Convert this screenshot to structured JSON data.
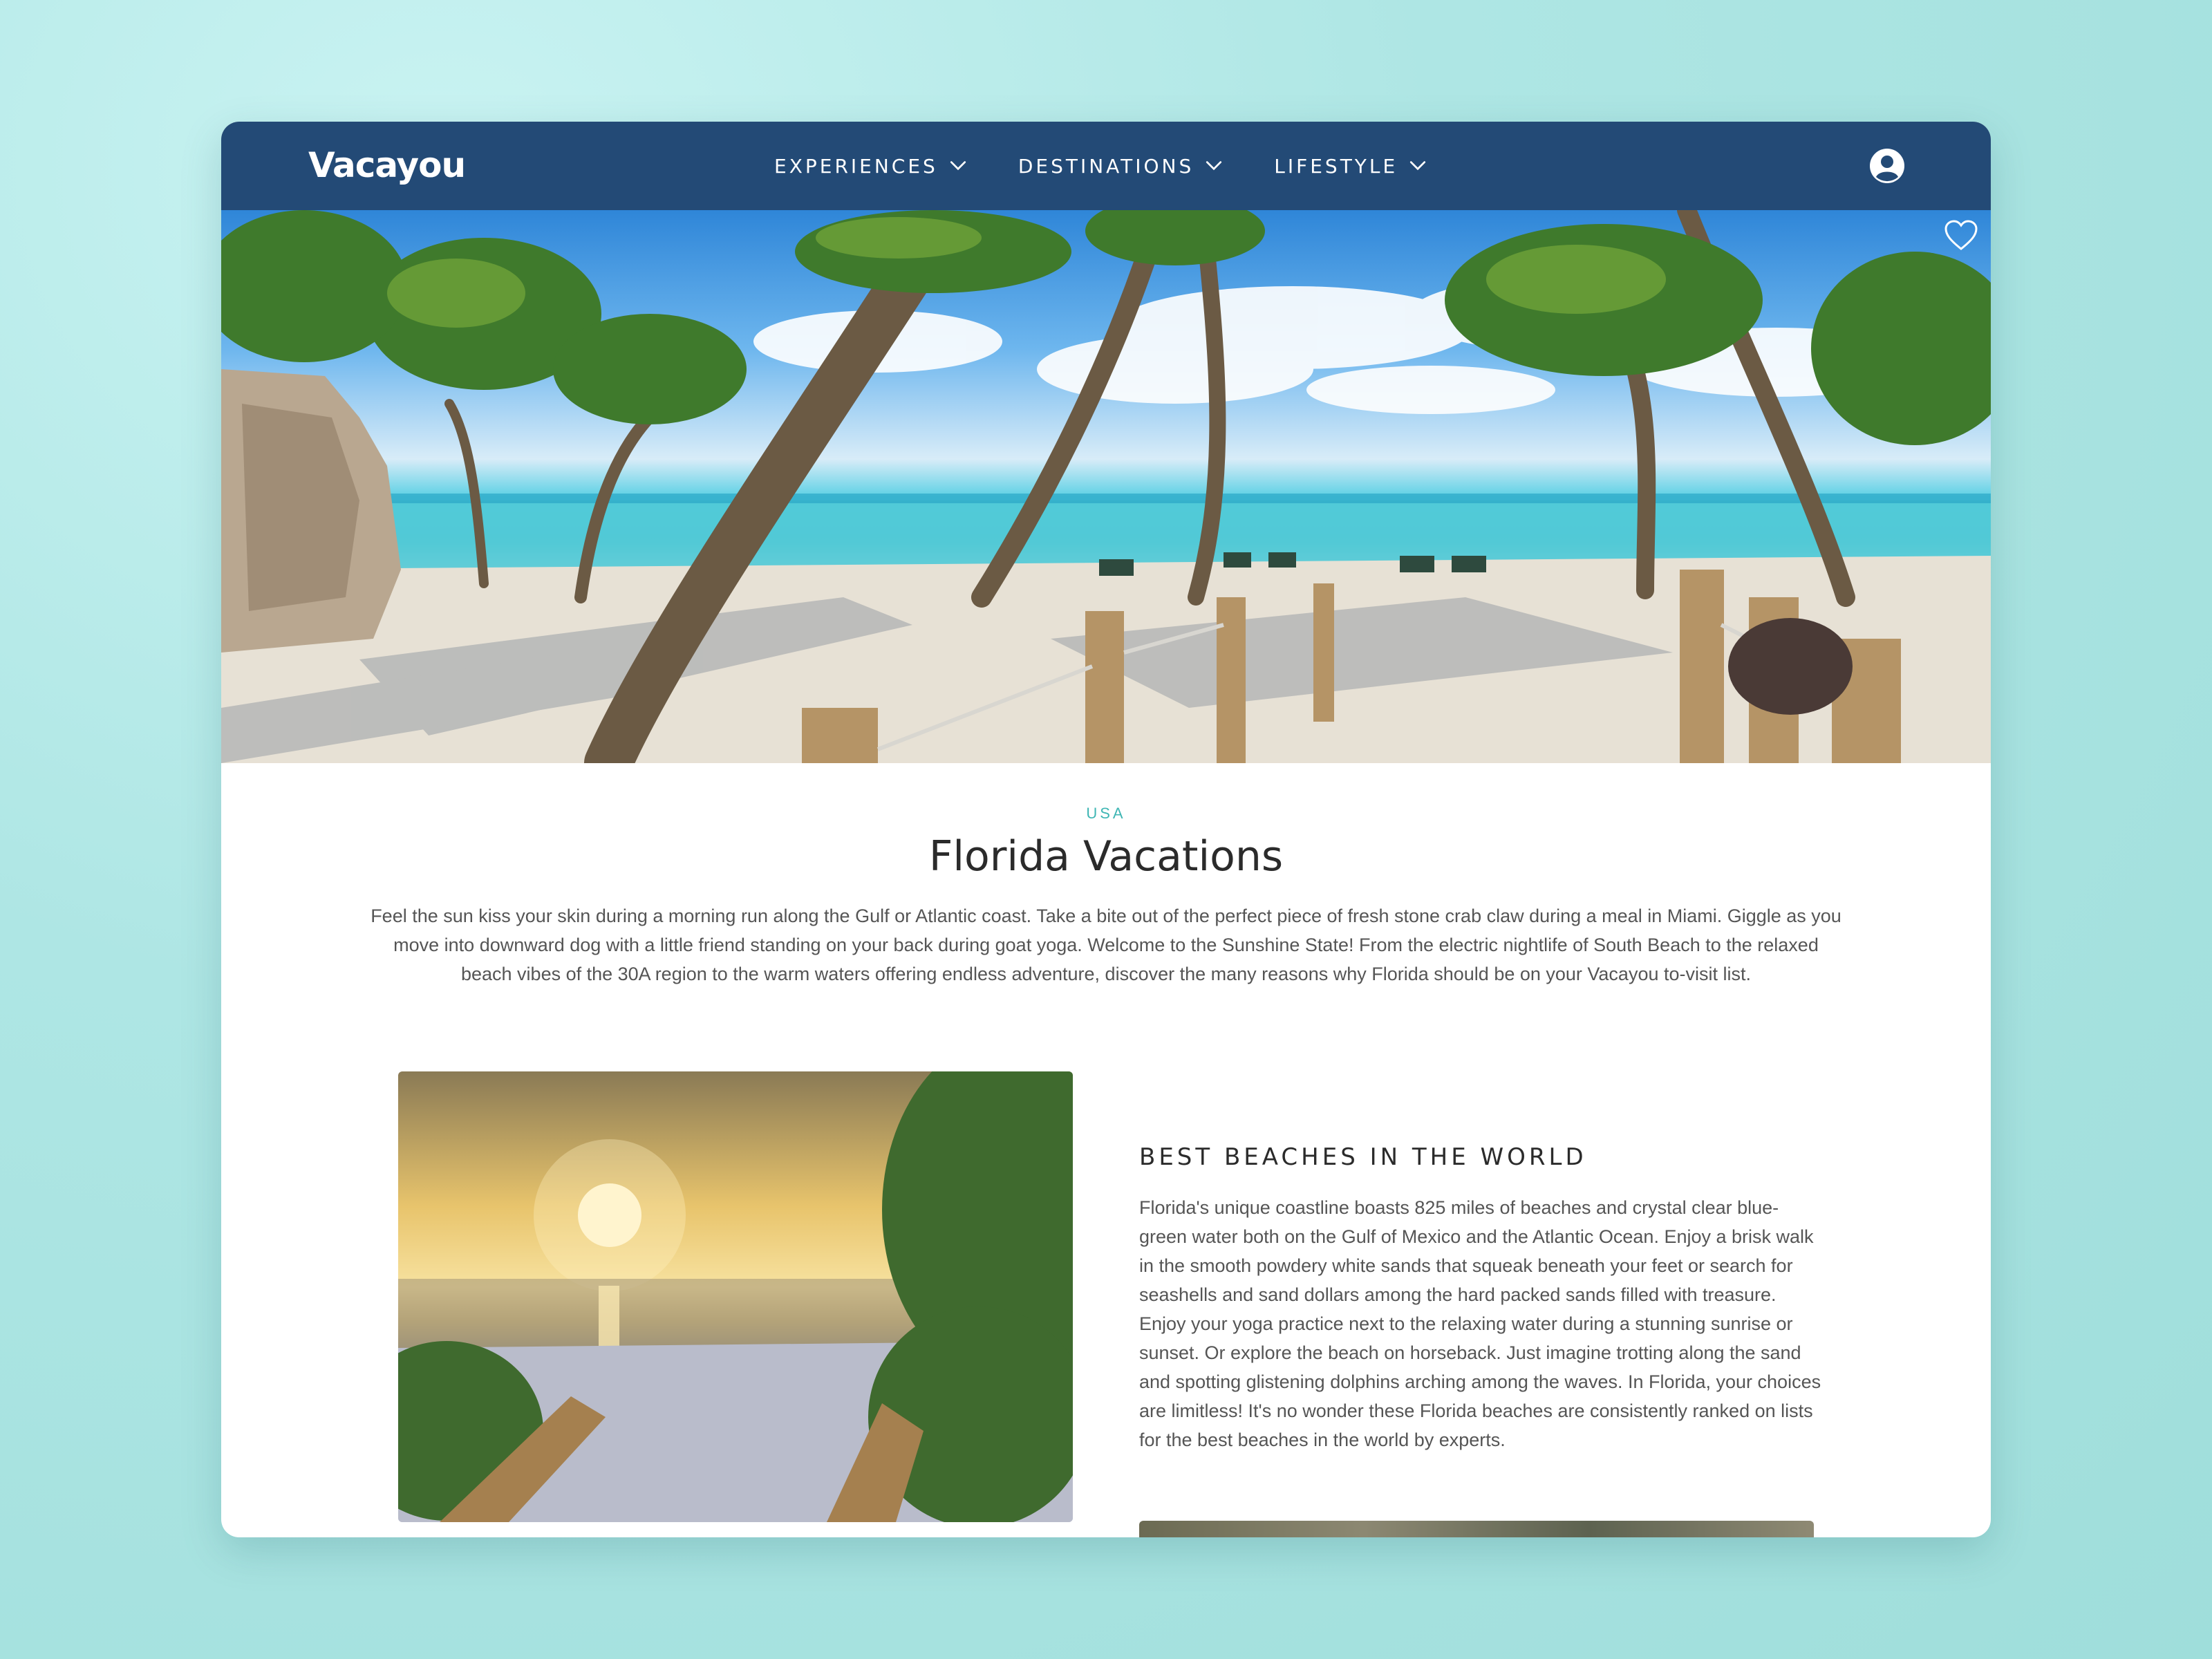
{
  "brand": {
    "logo": "Vacayou",
    "nav_color": "#234a76",
    "accent": "#3fb6b4"
  },
  "nav": {
    "items": [
      {
        "label": "EXPERIENCES",
        "icon": "chevron-down-icon"
      },
      {
        "label": "DESTINATIONS",
        "icon": "chevron-down-icon"
      },
      {
        "label": "LIFESTYLE",
        "icon": "chevron-down-icon"
      }
    ],
    "account_icon": "user-circle-icon"
  },
  "hero": {
    "favorite_icon": "heart-icon"
  },
  "page": {
    "region": "USA",
    "title": "Florida Vacations",
    "intro": "Feel the sun kiss your skin during a morning run along the Gulf or Atlantic coast. Take a bite out of the perfect piece of fresh stone crab claw during a meal in Miami. Giggle as you move into downward dog with a little friend standing on your back during goat yoga. Welcome to the Sunshine State! From the electric nightlife of South Beach to the relaxed beach vibes of the 30A region to the warm waters offering endless adventure, discover the many reasons why Florida should be on your Vacayou to-visit list."
  },
  "section": {
    "title": "BEST BEACHES IN THE WORLD",
    "body": "Florida's unique coastline boasts 825 miles of beaches and crystal clear blue-green water both on the Gulf of Mexico and the Atlantic Ocean. Enjoy a brisk walk in the smooth powdery white sands that squeak beneath your feet or search for seashells and sand dollars among the hard packed sands filled with treasure. Enjoy your yoga practice next to the relaxing water during a stunning sunrise or sunset. Or explore the beach on horseback. Just imagine trotting along the sand and spotting glistening dolphins arching among the waves. In Florida, your choices are limitless! It's no wonder these Florida beaches are consistently ranked on lists for the best beaches in the world by experts."
  }
}
